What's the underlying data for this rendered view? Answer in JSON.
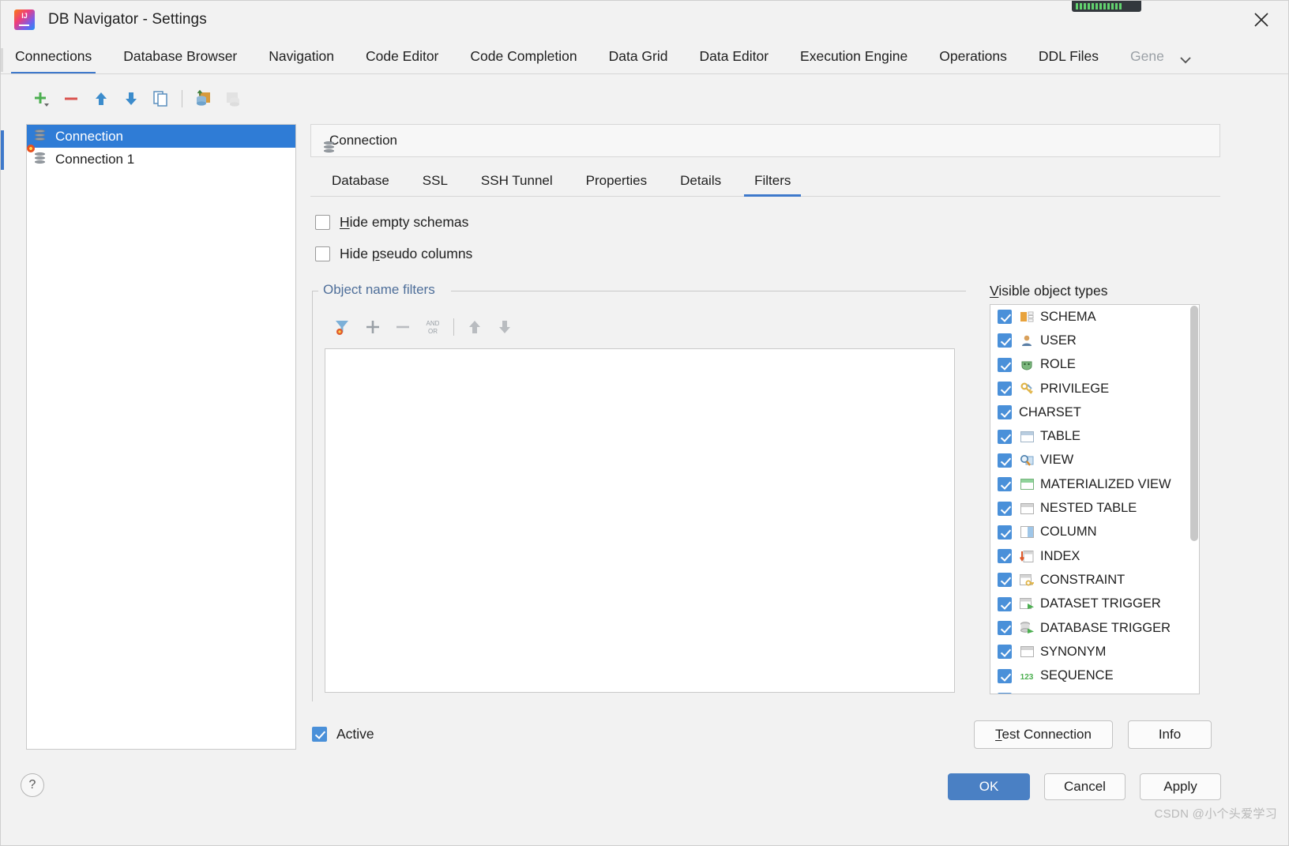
{
  "window": {
    "title": "DB Navigator - Settings",
    "logo_icon": "intellij-idea-logo",
    "close_icon": "close-icon"
  },
  "tabs": [
    {
      "label": "Connections",
      "active": true
    },
    {
      "label": "Database Browser",
      "active": false
    },
    {
      "label": "Navigation",
      "active": false
    },
    {
      "label": "Code Editor",
      "active": false
    },
    {
      "label": "Code Completion",
      "active": false
    },
    {
      "label": "Data Grid",
      "active": false
    },
    {
      "label": "Data Editor",
      "active": false
    },
    {
      "label": "Execution Engine",
      "active": false
    },
    {
      "label": "Operations",
      "active": false
    },
    {
      "label": "DDL Files",
      "active": false
    },
    {
      "label": "Gene",
      "active": false,
      "clipped": true
    }
  ],
  "tab_overflow_icon": "chevron-down-icon",
  "toolbar": [
    {
      "name": "add-connection-button",
      "icon": "plus-icon",
      "enabled": true
    },
    {
      "name": "remove-connection-button",
      "icon": "minus-icon",
      "enabled": true
    },
    {
      "name": "move-up-button",
      "icon": "arrow-up-icon",
      "enabled": true
    },
    {
      "name": "move-down-button",
      "icon": "arrow-down-icon",
      "enabled": true
    },
    {
      "name": "duplicate-connection-button",
      "icon": "copy-icon",
      "enabled": true
    },
    {
      "name": "import-connection-button",
      "icon": "import-database-icon",
      "enabled": true
    },
    {
      "name": "export-connection-button",
      "icon": "export-database-icon",
      "enabled": false
    }
  ],
  "connections": [
    {
      "label": "Connection",
      "selected": true,
      "status": "ok"
    },
    {
      "label": "Connection 1",
      "selected": false,
      "status": "error"
    }
  ],
  "detail": {
    "header": "Connection",
    "header_icon": "database-icon",
    "subtabs": [
      {
        "label": "Database",
        "active": false
      },
      {
        "label": "SSL",
        "active": false
      },
      {
        "label": "SSH Tunnel",
        "active": false
      },
      {
        "label": "Properties",
        "active": false
      },
      {
        "label": "Details",
        "active": false
      },
      {
        "label": "Filters",
        "active": true
      }
    ],
    "options": [
      {
        "label": "Hide empty schemas",
        "mnemonic": "H",
        "checked": false
      },
      {
        "label": "Hide pseudo columns",
        "mnemonic": "p",
        "checked": false
      }
    ],
    "filters_group": {
      "title": "Object name filters",
      "toolbar": [
        {
          "name": "filter-clear-button",
          "icon": "filter-icon",
          "enabled": true
        },
        {
          "name": "filter-add-button",
          "icon": "plus-icon",
          "enabled": true
        },
        {
          "name": "filter-remove-button",
          "icon": "minus-icon",
          "enabled": false
        },
        {
          "name": "filter-andor-button",
          "icon": "and-or-icon",
          "enabled": false,
          "label_top": "AND",
          "label_bottom": "OR"
        },
        {
          "name": "filter-move-up-button",
          "icon": "arrow-up-icon",
          "enabled": false
        },
        {
          "name": "filter-move-down-button",
          "icon": "arrow-down-icon",
          "enabled": false
        }
      ],
      "editor_value": ""
    },
    "visible_object_types": {
      "title": "Visible object types",
      "mnemonic": "V",
      "items": [
        {
          "label": "SCHEMA",
          "checked": true,
          "icon": "schema-icon"
        },
        {
          "label": "USER",
          "checked": true,
          "icon": "user-icon"
        },
        {
          "label": "ROLE",
          "checked": true,
          "icon": "role-icon"
        },
        {
          "label": "PRIVILEGE",
          "checked": true,
          "icon": "privilege-key-icon"
        },
        {
          "label": "CHARSET",
          "checked": true,
          "icon": "none"
        },
        {
          "label": "TABLE",
          "checked": true,
          "icon": "table-icon"
        },
        {
          "label": "VIEW",
          "checked": true,
          "icon": "view-icon"
        },
        {
          "label": "MATERIALIZED VIEW",
          "checked": true,
          "icon": "materialized-view-icon"
        },
        {
          "label": "NESTED TABLE",
          "checked": true,
          "icon": "nested-table-icon"
        },
        {
          "label": "COLUMN",
          "checked": true,
          "icon": "column-icon"
        },
        {
          "label": "INDEX",
          "checked": true,
          "icon": "index-icon"
        },
        {
          "label": "CONSTRAINT",
          "checked": true,
          "icon": "constraint-key-icon"
        },
        {
          "label": "DATASET TRIGGER",
          "checked": true,
          "icon": "dataset-trigger-icon"
        },
        {
          "label": "DATABASE TRIGGER",
          "checked": true,
          "icon": "database-trigger-icon"
        },
        {
          "label": "SYNONYM",
          "checked": true,
          "icon": "synonym-icon"
        },
        {
          "label": "SEQUENCE",
          "checked": true,
          "icon": "sequence-123-icon"
        }
      ]
    },
    "active_checkbox": {
      "label": "Active",
      "checked": true
    },
    "test_connection_button": "Test Connection",
    "test_connection_mnemonic": "T",
    "info_button": "Info"
  },
  "footer": {
    "help_icon": "question-mark-icon",
    "ok": "OK",
    "cancel": "Cancel",
    "apply": "Apply"
  },
  "watermark": {
    "line1": "CSDN @小个头爱学习"
  },
  "colors": {
    "accent": "#3e79cb",
    "selection": "#2f7cd6",
    "checkbox": "#4a90d9",
    "group_label": "#4f6f9a",
    "primary_button": "#4a80c4"
  }
}
